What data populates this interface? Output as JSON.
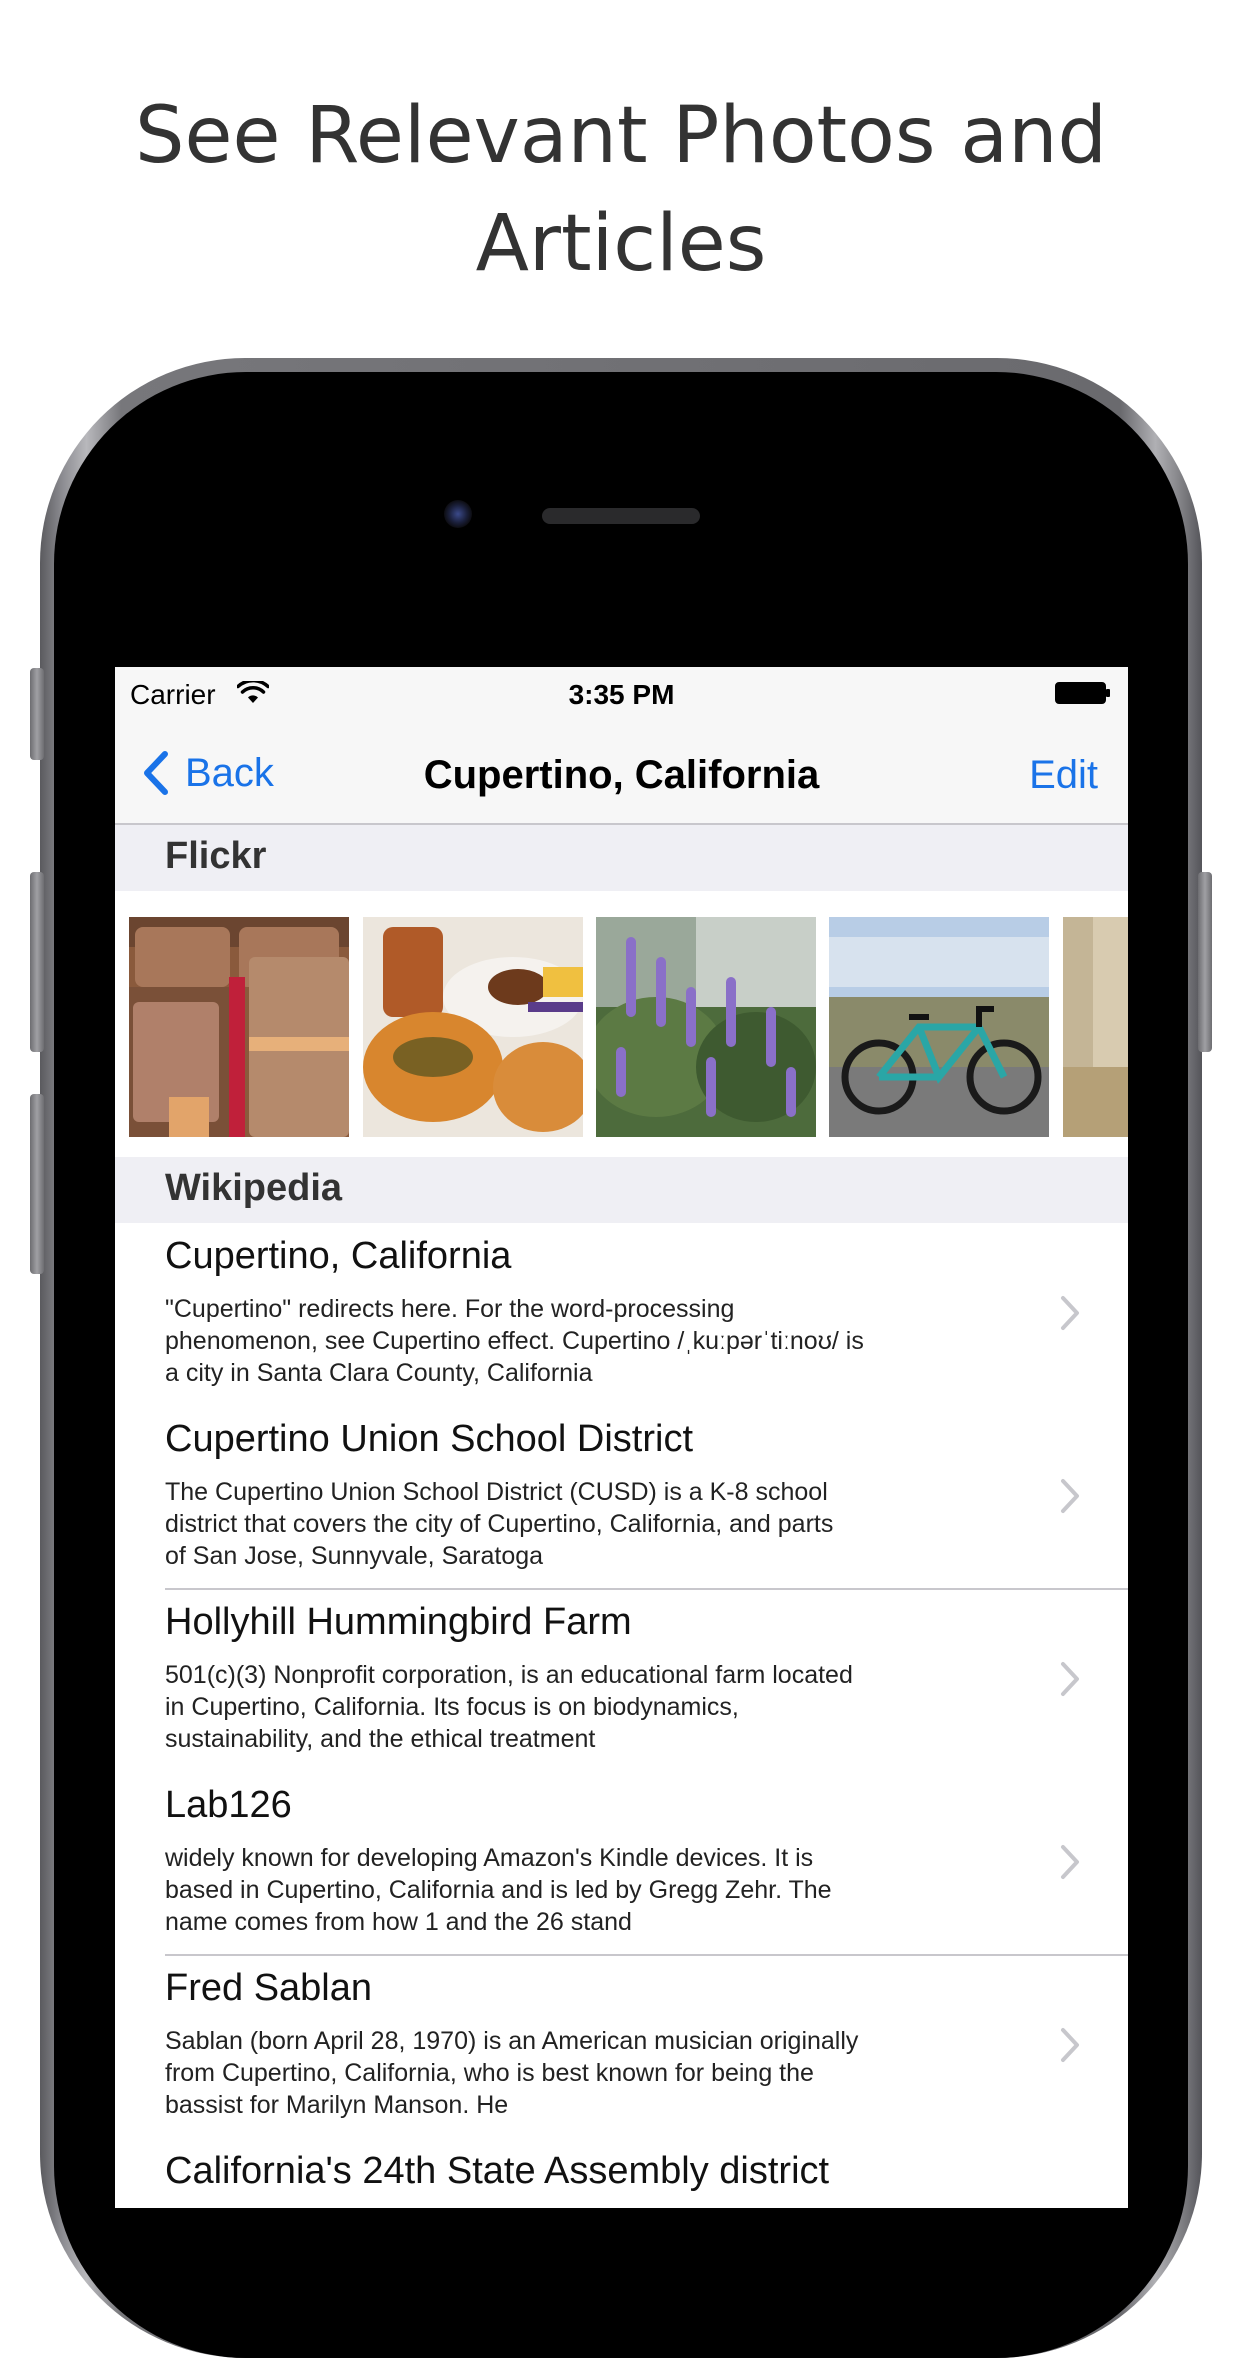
{
  "headline": {
    "line1": "See Relevant Photos and",
    "line2": "Articles"
  },
  "statusbar": {
    "carrier": "Carrier",
    "time": "3:35 PM"
  },
  "navbar": {
    "back_label": "Back",
    "title": "Cupertino, California",
    "edit_label": "Edit"
  },
  "sections": {
    "flickr": "Flickr",
    "wikipedia": "Wikipedia"
  },
  "colors": {
    "accent": "#1a73e8",
    "section_bg": "#efeff4",
    "bar_bg": "#f7f7f7"
  },
  "articles": [
    {
      "title": "Cupertino, California",
      "line1": "\"Cupertino\" redirects here. For the word-processing",
      "line2": "phenomenon, see Cupertino effect. Cupertino /ˌkuːpərˈtiːnoʊ/ is",
      "line3": "a city in Santa Clara County, California"
    },
    {
      "title": "Cupertino Union School District",
      "line1": "The Cupertino Union School District (CUSD) is a K-8 school",
      "line2": "district that covers the city of Cupertino, California, and parts",
      "line3": "of San Jose, Sunnyvale, Saratoga"
    },
    {
      "title": "Hollyhill Hummingbird Farm",
      "line1": "501(c)(3) Nonprofit corporation, is an educational farm located",
      "line2": "in Cupertino, California. Its focus is on biodynamics,",
      "line3": "sustainability, and the ethical treatment"
    },
    {
      "title": "Lab126",
      "line1": "widely known for developing Amazon's Kindle devices. It is",
      "line2": "based in Cupertino, California and is led by Gregg Zehr. The",
      "line3": "name comes from how 1 and the 26 stand"
    },
    {
      "title": "Fred Sablan",
      "line1": "Sablan (born April 28, 1970) is an American musician originally",
      "line2": "from Cupertino, California, who is best known for being the",
      "line3": "bassist for Marilyn Manson. He"
    },
    {
      "title": "California's 24th State Assembly district",
      "line1": "",
      "line2": "",
      "line3": ""
    }
  ]
}
